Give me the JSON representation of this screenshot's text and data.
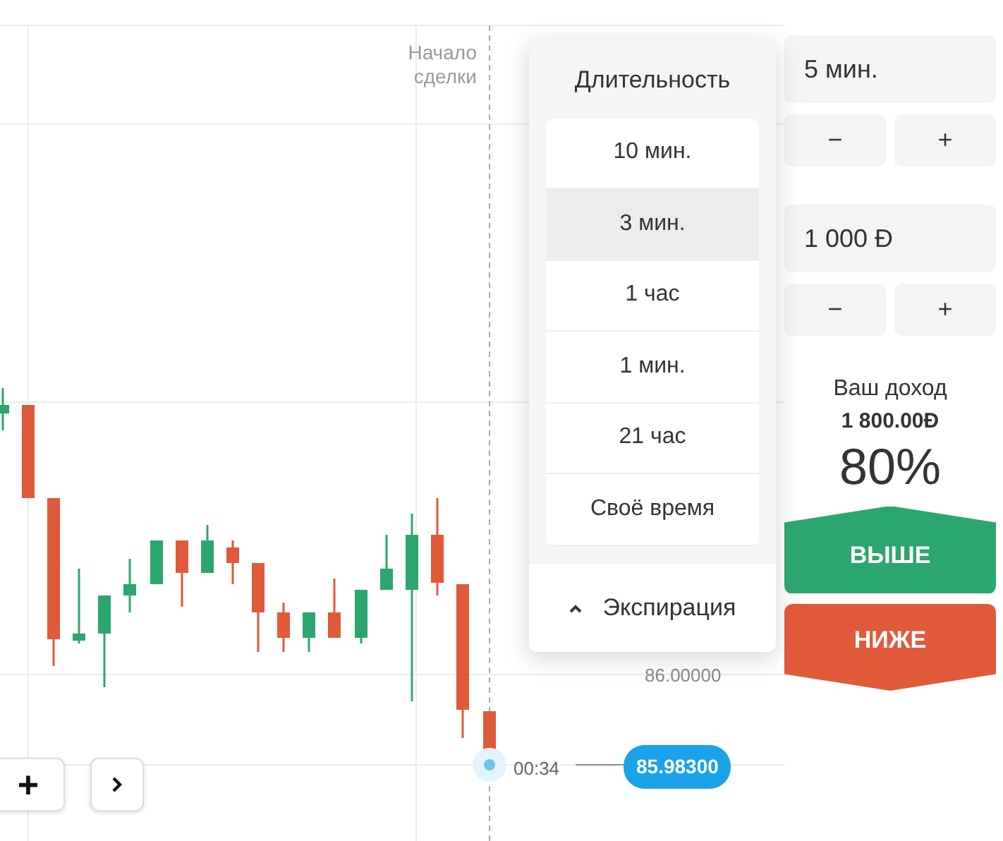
{
  "chart": {
    "trade_start_label": "Начало сделки",
    "price_label": "86.00000",
    "timer": "00:34",
    "current_price": "85.98300",
    "zoom_in_label": "+"
  },
  "duration_menu": {
    "title": "Длительность",
    "options": [
      {
        "label": "10 мин.",
        "selected": false
      },
      {
        "label": "3 мин.",
        "selected": true
      },
      {
        "label": "1 час",
        "selected": false
      },
      {
        "label": "1 мин.",
        "selected": false
      },
      {
        "label": "21 час",
        "selected": false
      },
      {
        "label": "Своё время",
        "selected": false
      }
    ],
    "footer": {
      "label": "Экспирация",
      "expanded": true
    }
  },
  "panel": {
    "duration": "5 мин.",
    "duration_steppers": [
      "−",
      "+"
    ],
    "amount": "1 000 Đ",
    "amount_steppers": [
      "−",
      "+"
    ],
    "payout_label": "Ваш доход",
    "payout_amount": "1 800.00Đ",
    "payout_percent": "80%",
    "trade_buttons": [
      {
        "kind": "up",
        "label": "ВЫШЕ"
      },
      {
        "kind": "down",
        "label": "НИЖЕ"
      }
    ]
  }
}
